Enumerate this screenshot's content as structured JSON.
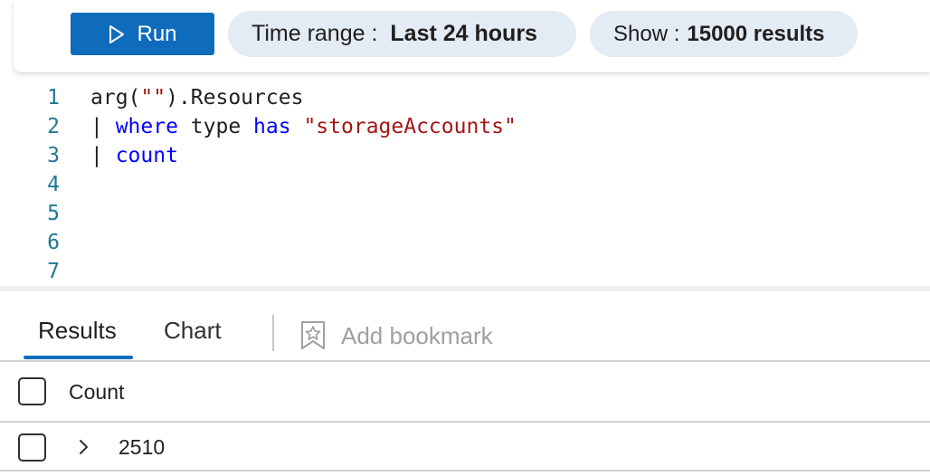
{
  "toolbar": {
    "run_label": "Run",
    "time_range": {
      "label": "Time range :",
      "value": "Last 24 hours"
    },
    "show": {
      "label": "Show :",
      "value": "15000 results"
    }
  },
  "editor": {
    "lines": [
      {
        "number": "1",
        "tokens": [
          {
            "text": "arg(",
            "kind": "plain"
          },
          {
            "text": "\"\"",
            "kind": "string"
          },
          {
            "text": ").Resources",
            "kind": "plain"
          }
        ]
      },
      {
        "number": "2",
        "tokens": [
          {
            "text": "| ",
            "kind": "plain"
          },
          {
            "text": "where",
            "kind": "keyword"
          },
          {
            "text": " type ",
            "kind": "plain"
          },
          {
            "text": "has",
            "kind": "keyword"
          },
          {
            "text": " ",
            "kind": "plain"
          },
          {
            "text": "\"storageAccounts\"",
            "kind": "string"
          }
        ]
      },
      {
        "number": "3",
        "tokens": [
          {
            "text": "| ",
            "kind": "plain"
          },
          {
            "text": "count",
            "kind": "keyword"
          }
        ]
      },
      {
        "number": "4",
        "tokens": []
      },
      {
        "number": "5",
        "tokens": []
      },
      {
        "number": "6",
        "tokens": []
      },
      {
        "number": "7",
        "tokens": []
      }
    ]
  },
  "tabs": {
    "results": "Results",
    "chart": "Chart",
    "bookmark": "Add bookmark"
  },
  "table": {
    "column": "Count",
    "rows": [
      {
        "count": "2510"
      }
    ]
  },
  "colors": {
    "accent": "#0f6cbd",
    "pill_bg": "#e3ebf5",
    "keyword": "#0000ff",
    "string": "#a31515",
    "line_number": "#237893"
  },
  "icons": {
    "run": "play-icon",
    "bookmark": "bookmark-star-icon",
    "expand": "chevron-right-icon"
  }
}
